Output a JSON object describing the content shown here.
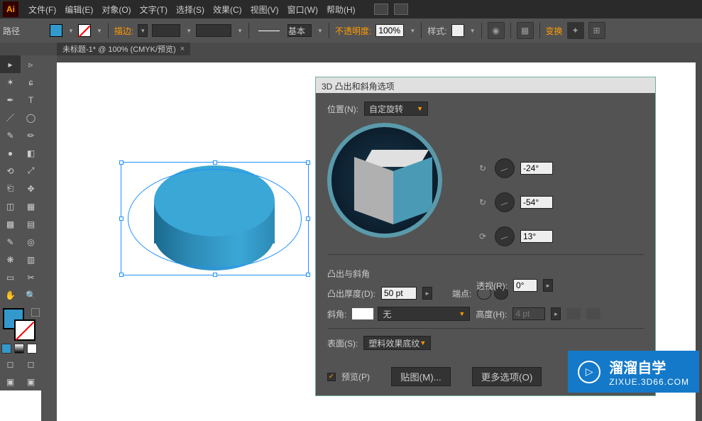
{
  "app": {
    "logo_text": "Ai"
  },
  "menu": {
    "file": "文件(F)",
    "edit": "编辑(E)",
    "object": "对象(O)",
    "type": "文字(T)",
    "select": "选择(S)",
    "effect": "效果(C)",
    "view": "视图(V)",
    "window": "窗口(W)",
    "help": "帮助(H)"
  },
  "options": {
    "path_label": "路径",
    "stroke_label": "描边:",
    "stroke_width": "",
    "brush_basic": "基本",
    "opacity_label": "不透明度:",
    "opacity_value": "100%",
    "style_label": "样式:",
    "transform_label": "变换"
  },
  "tab": {
    "title": "未标题-1* @ 100% (CMYK/预览)",
    "close": "×"
  },
  "dialog": {
    "title": "3D 凸出和斜角选项",
    "position_label": "位置(N):",
    "position_value": "自定旋转",
    "angle_x": "-24°",
    "angle_y": "-54°",
    "angle_z": "13°",
    "perspective_label": "透视(R):",
    "perspective_value": "0°",
    "extrude_section": "凸出与斜角",
    "extrude_depth_label": "凸出厚度(D):",
    "extrude_depth_value": "50 pt",
    "cap_label": "端点:",
    "bevel_label": "斜角:",
    "bevel_value": "无",
    "bevel_height_label": "高度(H):",
    "bevel_height_value": "4 pt",
    "surface_label": "表面(S):",
    "surface_value": "塑料效果底纹",
    "preview_label": "预览(P)",
    "map_art_btn": "贴图(M)...",
    "more_options_btn": "更多选项(O)"
  },
  "watermark": {
    "main": "溜溜自学",
    "sub": "ZIXUE.3D66.COM",
    "logo": "▷"
  }
}
